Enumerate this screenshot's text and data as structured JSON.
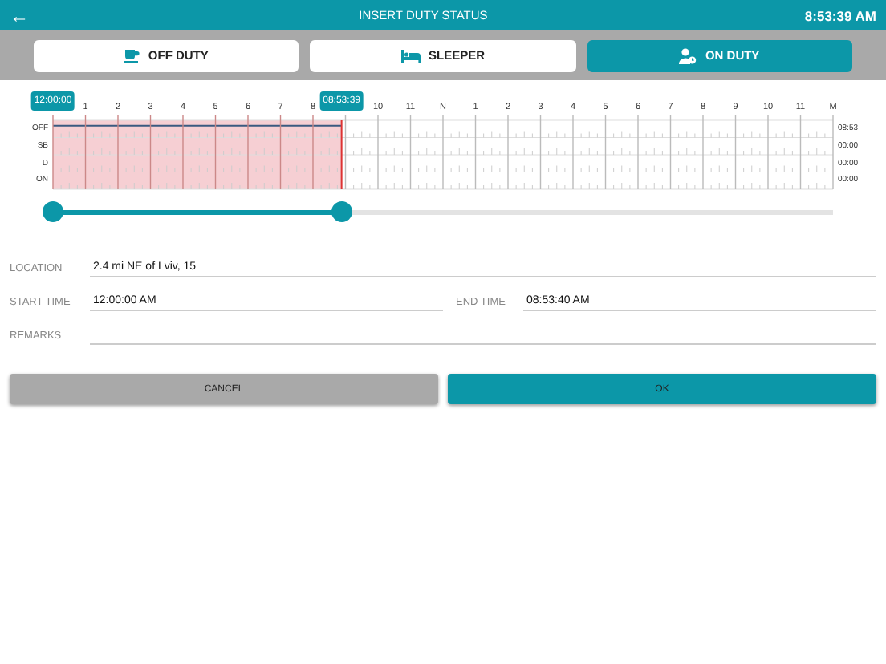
{
  "header": {
    "back": "←",
    "title": "INSERT DUTY STATUS",
    "time": "8:53:39 AM"
  },
  "status_tabs": [
    {
      "label": "OFF DUTY",
      "selected": false
    },
    {
      "label": "SLEEPER",
      "selected": false
    },
    {
      "label": "ON DUTY",
      "selected": true
    }
  ],
  "log": {
    "hour_labels": [
      "1",
      "2",
      "3",
      "4",
      "5",
      "6",
      "7",
      "8",
      "10",
      "11",
      "N",
      "1",
      "2",
      "3",
      "4",
      "5",
      "6",
      "7",
      "8",
      "9",
      "10",
      "11",
      "M"
    ],
    "rows": [
      {
        "label": "OFF",
        "total": "08:53"
      },
      {
        "label": "SB",
        "total": "00:00"
      },
      {
        "label": "D",
        "total": "00:00"
      },
      {
        "label": "ON",
        "total": "00:00"
      }
    ]
  },
  "slider": {
    "thumbs": [
      {
        "level": 0,
        "tooltip": "12:00:00"
      },
      {
        "level": 0.37,
        "tooltip": "08:53:39"
      }
    ]
  },
  "form": {
    "location": {
      "label": "LOCATION",
      "value": "2.4 mi NE of Lviv, 15"
    },
    "start_time": {
      "label": "START TIME",
      "value": "12:00:00 AM"
    },
    "end_time": {
      "label": "END TIME",
      "value": "08:53:40 AM"
    },
    "remarks": {
      "label": "REMARKS"
    }
  },
  "buttons": [
    {
      "label": "CANCEL",
      "kind": "secondary"
    },
    {
      "label": "OK",
      "kind": "primary"
    }
  ]
}
